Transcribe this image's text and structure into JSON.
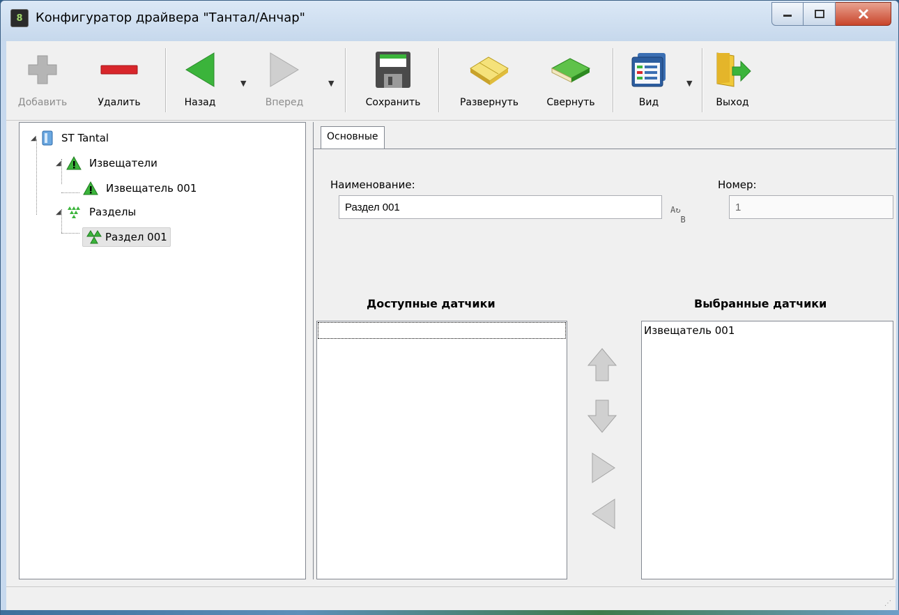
{
  "window": {
    "title": "Конфигуратор драйвера \"Тантал/Анчар\""
  },
  "toolbar": {
    "add_label": "Добавить",
    "delete_label": "Удалить",
    "back_label": "Назад",
    "forward_label": "Вперед",
    "save_label": "Сохранить",
    "expand_label": "Развернуть",
    "collapse_label": "Свернуть",
    "view_label": "Вид",
    "exit_label": "Выход"
  },
  "tree": {
    "root": "ST Tantal",
    "detectors_group": "Извещатели",
    "detector_item": "Извещатель 001",
    "sections_group": "Разделы",
    "section_item": "Раздел 001"
  },
  "tabs": {
    "main": "Основные"
  },
  "form": {
    "name_label": "Наименование:",
    "name_value": "Раздел 001",
    "number_label": "Номер:",
    "number_value": "1"
  },
  "lists": {
    "available_title": "Доступные датчики",
    "selected_title": "Выбранные датчики",
    "selected_items": [
      "Извещатель 001"
    ]
  },
  "colors": {
    "accent_green": "#3bb43b",
    "delete_red": "#d8262b",
    "title_bar": "#c6d8ec"
  }
}
